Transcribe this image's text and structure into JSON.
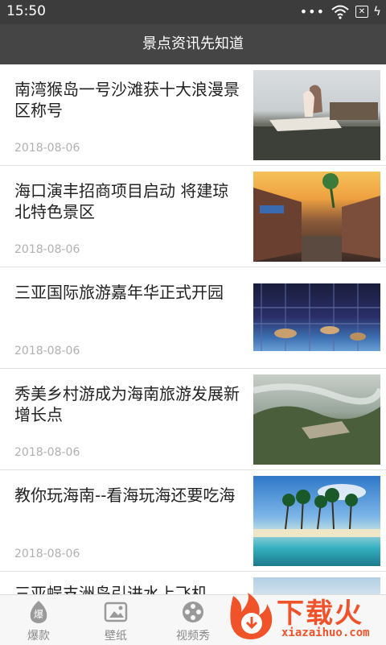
{
  "status_bar": {
    "time": "15:50",
    "dots": "•••"
  },
  "header": {
    "title": "景点资讯先知道"
  },
  "articles": [
    {
      "title": "南湾猴岛一号沙滩获十大浪漫景区称号",
      "date": "2018-08-06"
    },
    {
      "title": "海口演丰招商项目启动 将建琼北特色景区",
      "date": "2018-08-06"
    },
    {
      "title": "三亚国际旅游嘉年华正式开园",
      "date": "2018-08-06"
    },
    {
      "title": "秀美乡村游成为海南旅游发展新增长点",
      "date": "2018-08-06"
    },
    {
      "title": "教你玩海南--看海玩海还要吃海",
      "date": "2018-08-06"
    },
    {
      "title": "三亚蜈支洲岛引进水上飞机"
    }
  ],
  "bottom_nav": {
    "items": [
      {
        "label": "爆款",
        "icon": "fire-badge-icon"
      },
      {
        "label": "壁纸",
        "icon": "wallpaper-icon"
      },
      {
        "label": "视频秀",
        "icon": "film-reel-icon"
      }
    ]
  },
  "watermark": {
    "text": "下载火",
    "url": "xiazaihuo.com"
  },
  "colors": {
    "header_bg": "#454545",
    "status_bg": "#3c3c3c",
    "watermark": "#f0522a",
    "date": "#b0b0b0"
  }
}
